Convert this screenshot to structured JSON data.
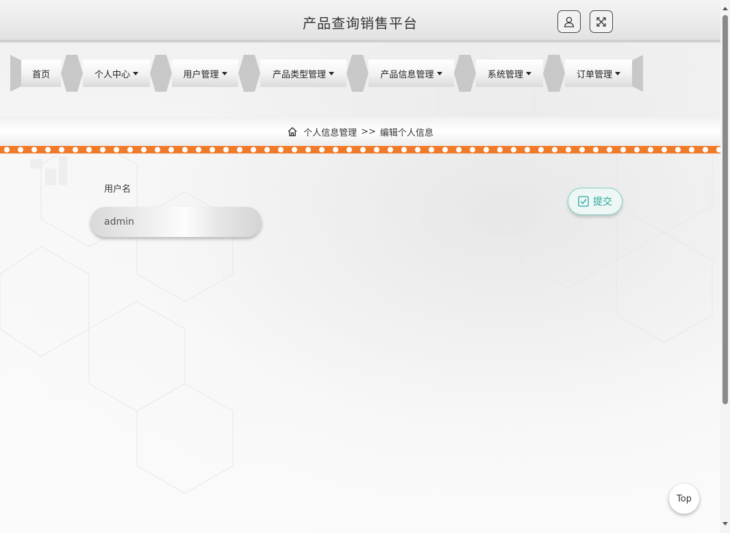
{
  "header": {
    "title": "产品查询销售平台",
    "user_icon": "user-icon",
    "fullscreen_icon": "fullscreen-icon"
  },
  "nav": {
    "items": [
      {
        "label": "首页",
        "dropdown": false
      },
      {
        "label": "个人中心",
        "dropdown": true
      },
      {
        "label": "用户管理",
        "dropdown": true
      },
      {
        "label": "产品类型管理",
        "dropdown": true
      },
      {
        "label": "产品信息管理",
        "dropdown": true
      },
      {
        "label": "系统管理",
        "dropdown": true
      },
      {
        "label": "订单管理",
        "dropdown": true
      }
    ]
  },
  "breadcrumb": {
    "home_icon": "home-icon",
    "section": "个人信息管理",
    "separator": ">>",
    "current": "编辑个人信息"
  },
  "form": {
    "username_label": "用户名",
    "username_value": "admin",
    "submit_label": "提交"
  },
  "top_button": "Top",
  "colors": {
    "accent_orange": "#f07a2a",
    "submit_teal": "#2aa79b"
  }
}
